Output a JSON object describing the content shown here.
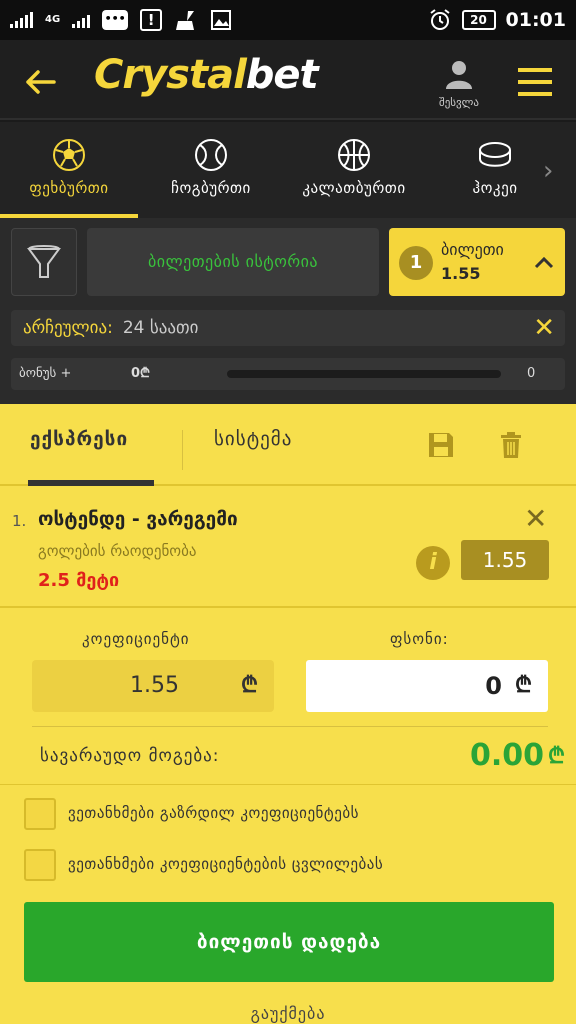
{
  "status_bar": {
    "network": "4G",
    "battery": "20",
    "time": "01:01"
  },
  "header": {
    "logo_part1": "Crystal",
    "logo_part2": "bet",
    "profile_label": "შესვლა"
  },
  "sports": [
    {
      "label": "ფეხბურთი",
      "icon": "soccer-ball-icon",
      "active": true
    },
    {
      "label": "ჩოგბურთი",
      "icon": "tennis-ball-icon",
      "active": false
    },
    {
      "label": "კალათბურთი",
      "icon": "basketball-icon",
      "active": false
    },
    {
      "label": "ჰოკეი",
      "icon": "hockey-puck-icon",
      "active": false
    }
  ],
  "filters": {
    "history_label": "ბილეთების ისტორია",
    "ticket_count": "1",
    "ticket_label": "ბილეთი",
    "ticket_odds": "1.55",
    "selected_label": "არჩეულია:",
    "selected_value": "24 საათი",
    "bonus_label": "ბონუს +",
    "bonus_value": "0₾",
    "bonus_max": "0",
    "bonus_progress": 0
  },
  "slip": {
    "tab_express": "ექსპრესი",
    "tab_system": "სისტემა",
    "event": {
      "number": "1.",
      "name": "ოსტენდე - ვარეგემი",
      "market": "გოლების რაოდენობა",
      "pick": "2.5 მეტი",
      "odds": "1.55"
    },
    "coef_label": "კოეფიციენტი",
    "coef_value": "1.55",
    "stake_label": "ფსონი:",
    "stake_value": "0",
    "currency": "₾",
    "potential_label": "სავარაუდო მოგება:",
    "potential_value": "0.00",
    "agree_increased": "ვეთანხმები გაზრდილ კოეფიციენტებს",
    "agree_changes": "ვეთანხმები კოეფიციენტების ცვლილებას",
    "place_button": "ბილეთის დადება",
    "cancel_button": "გაუქმება"
  }
}
